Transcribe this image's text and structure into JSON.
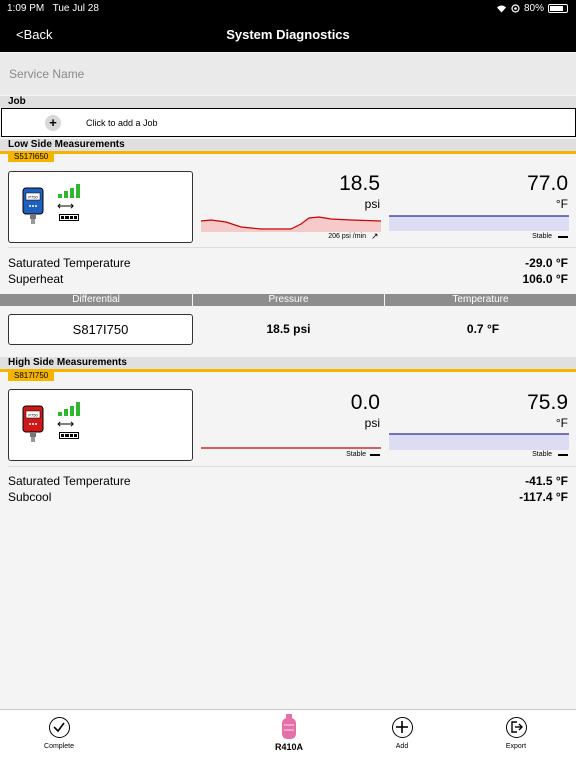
{
  "status": {
    "time": "1:09 PM",
    "date": "Tue Jul 28",
    "battery": "80%"
  },
  "nav": {
    "back": "<Back",
    "title": "System Diagnostics"
  },
  "service": {
    "placeholder": "Service Name"
  },
  "job": {
    "header": "Job",
    "add_label": "Click to add a Job"
  },
  "low_side": {
    "header": "Low Side Measurements",
    "serial": "S517I650",
    "pressure": "18.5",
    "pressure_unit": "psi",
    "rate": "206 psi /min",
    "temperature": "77.0",
    "temperature_unit": "°F",
    "temp_status": "Stable",
    "sat_temp_label": "Saturated Temperature",
    "sat_temp_value": "-29.0 °F",
    "extra_label": "Superheat",
    "extra_value": "106.0 °F"
  },
  "differential": {
    "headers": [
      "Differential",
      "Pressure",
      "Temperature"
    ],
    "serial": "S817I750",
    "pressure": "18.5 psi",
    "temperature": "0.7 °F"
  },
  "high_side": {
    "header": "High Side Measurements",
    "serial": "S817I750",
    "pressure": "0.0",
    "pressure_unit": "psi",
    "pressure_status": "Stable",
    "temperature": "75.9",
    "temperature_unit": "°F",
    "temp_status": "Stable",
    "sat_temp_label": "Saturated Temperature",
    "sat_temp_value": "-41.5 °F",
    "extra_label": "Subcool",
    "extra_value": "-117.4 °F"
  },
  "tabs": {
    "complete": "Complete",
    "refrigerant": "R410A",
    "add": "Add",
    "export": "Export"
  },
  "colors": {
    "accent": "#f5b400",
    "low_probe": "#1f5fc0",
    "high_probe": "#d01818",
    "pressure_line": "#cc0000",
    "temp_line": "#2a2aa8"
  }
}
